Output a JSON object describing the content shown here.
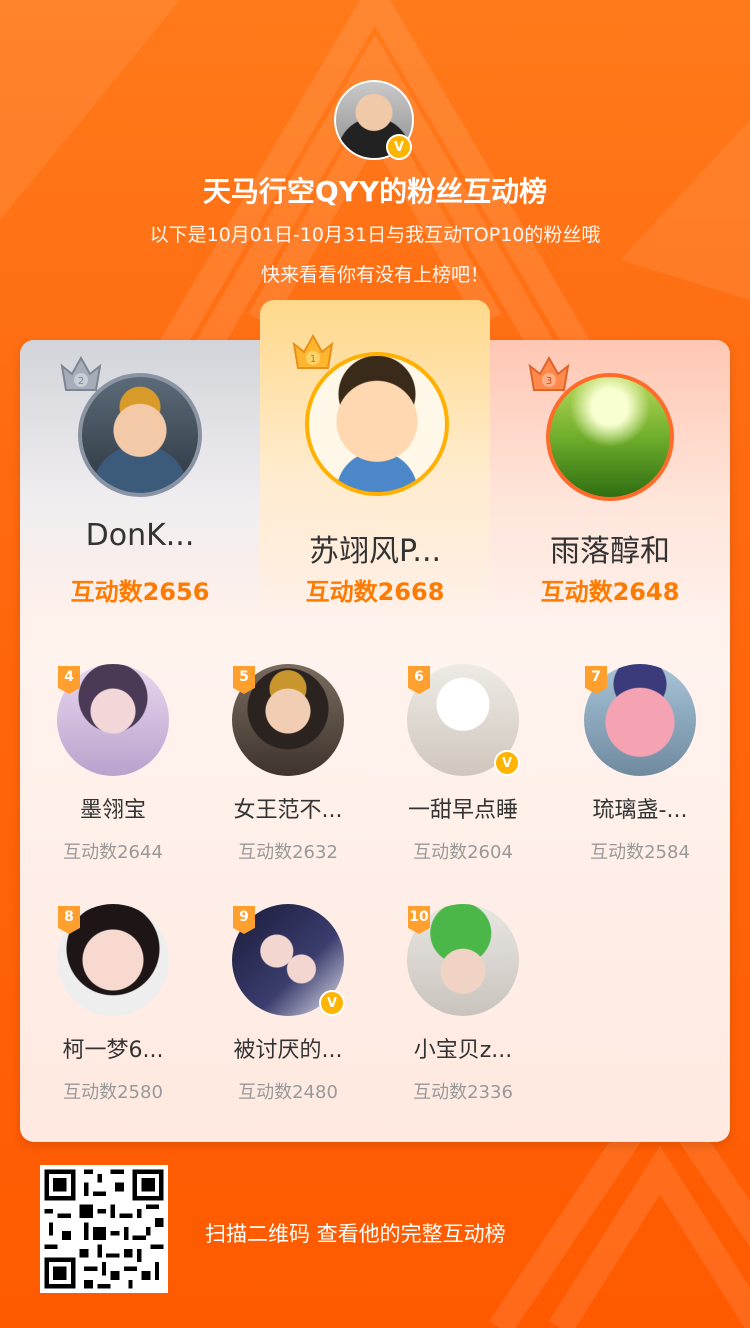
{
  "header": {
    "title": "天马行空QYY的粉丝互动榜",
    "subtitle1": "以下是10月01日-10月31日与我互动TOP10的粉丝哦",
    "subtitle2": "快来看看你有没有上榜吧！",
    "verified_badge": "V"
  },
  "podium": [
    {
      "rank": 2,
      "name": "DonK...",
      "score_label": "互动数2656"
    },
    {
      "rank": 1,
      "name": "苏翊风P...",
      "score_label": "互动数2668"
    },
    {
      "rank": 3,
      "name": "雨落醇和",
      "score_label": "互动数2648"
    }
  ],
  "fans": [
    {
      "rank": "4",
      "name": "墨翎宝",
      "score_label": "互动数2644"
    },
    {
      "rank": "5",
      "name": "女王范不...",
      "score_label": "互动数2632"
    },
    {
      "rank": "6",
      "name": "一甜早点睡",
      "score_label": "互动数2604",
      "verified": true
    },
    {
      "rank": "7",
      "name": "琉璃盏-...",
      "score_label": "互动数2584"
    },
    {
      "rank": "8",
      "name": "柯一梦6...",
      "score_label": "互动数2580"
    },
    {
      "rank": "9",
      "name": "被讨厌的...",
      "score_label": "互动数2480",
      "verified": true
    },
    {
      "rank": "10",
      "name": "小宝贝z...",
      "score_label": "互动数2336"
    }
  ],
  "footer": {
    "scan_text": "扫描二维码 查看他的完整互动榜"
  },
  "colors": {
    "accent": "#ff7a00",
    "gold": "#ffb400",
    "silver": "#9aa0ab",
    "bronze": "#ff7c4a"
  }
}
